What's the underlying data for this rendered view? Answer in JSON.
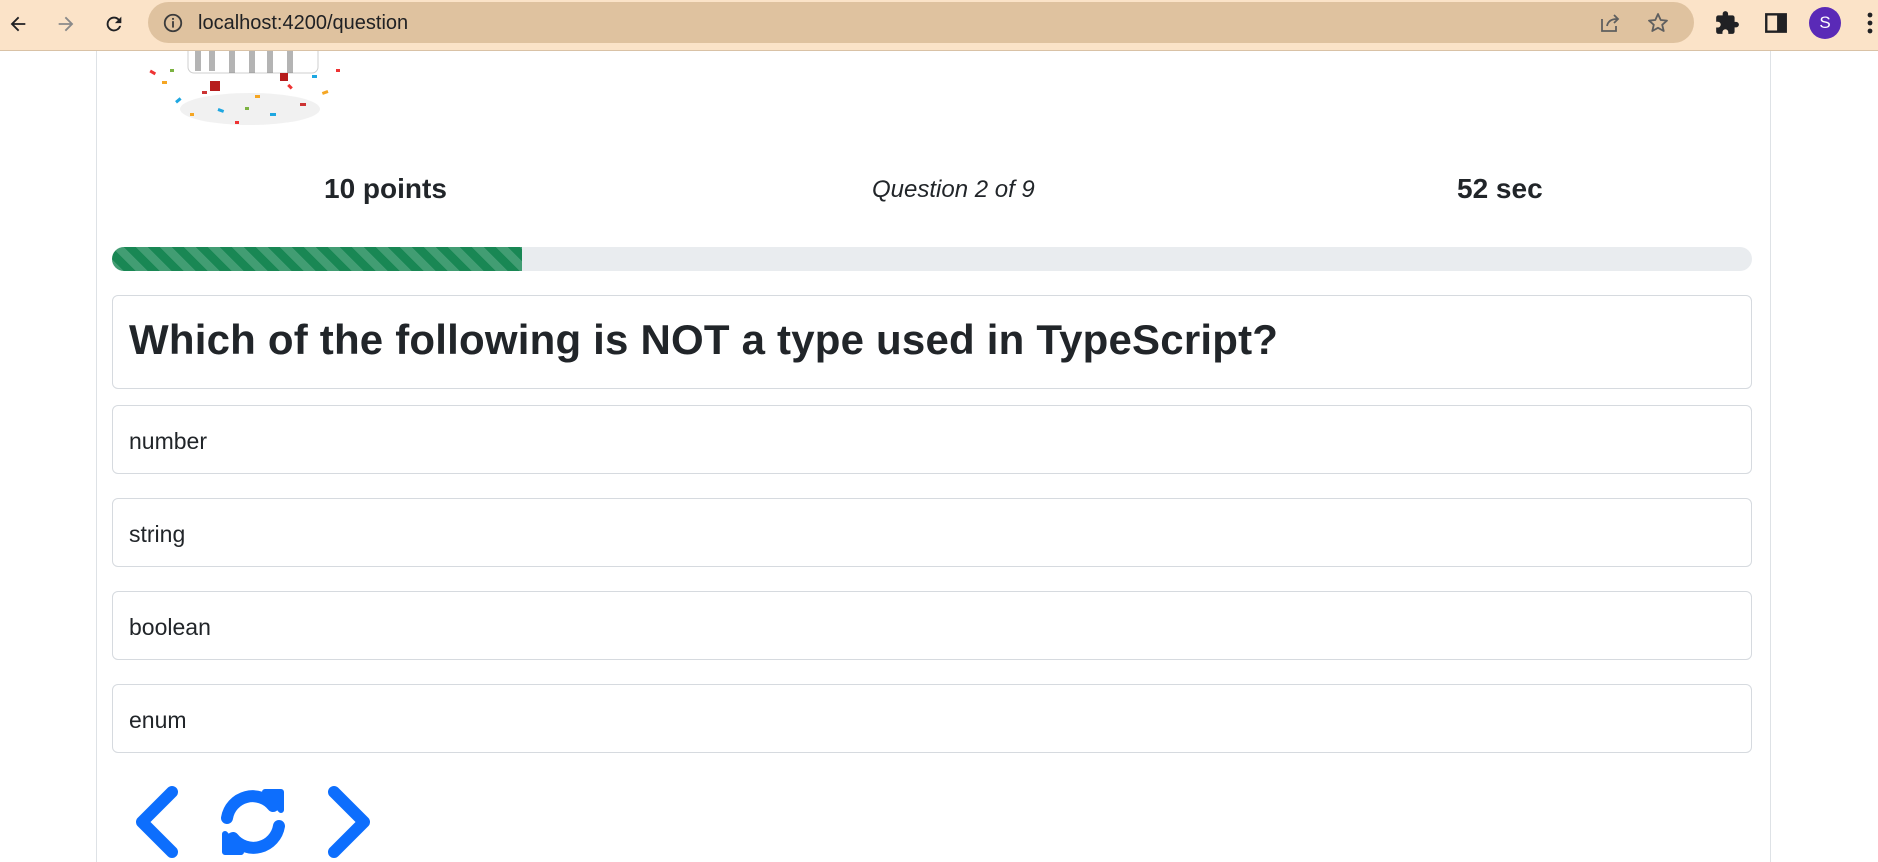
{
  "browser": {
    "url": "localhost:4200/question",
    "profile_initial": "S",
    "icons": [
      "back-icon",
      "forward-icon",
      "reload-icon",
      "info-icon",
      "share-icon",
      "star-icon",
      "extensions-icon",
      "side-panel-icon",
      "menu-icon"
    ]
  },
  "quiz": {
    "points": "10 points",
    "question_counter": "Question 2 of 9",
    "timer": "52 sec",
    "progress_fraction": 0.25,
    "question": "Which of the following is NOT a type used in TypeScript?",
    "options": [
      "number",
      "string",
      "boolean",
      "enum"
    ]
  },
  "controls": {
    "icons": [
      "chevron-left-icon",
      "refresh-icon",
      "chevron-right-icon"
    ],
    "color": "#0d6efd"
  },
  "colors": {
    "progress": "#198754",
    "chrome": "#fbe3c8",
    "omnibox": "#dfc29f",
    "avatar": "#5a2ab7"
  }
}
